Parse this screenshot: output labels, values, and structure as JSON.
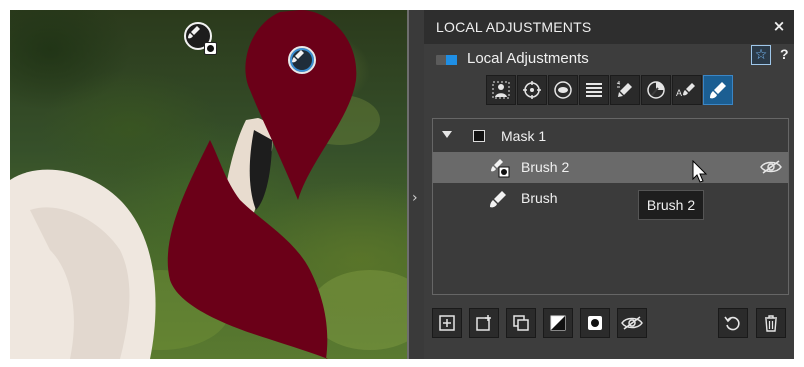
{
  "panel": {
    "title": "LOCAL ADJUSTMENTS",
    "close_label": "×",
    "subtitle": "Local Adjustments",
    "help_label": "?",
    "accent_color": "#1f8fe5"
  },
  "toolbar": {
    "tools": [
      {
        "icon": "automask-icon"
      },
      {
        "icon": "control-point-icon"
      },
      {
        "icon": "radial-mask-icon"
      },
      {
        "icon": "graduated-mask-icon"
      },
      {
        "icon": "color-picker-icon"
      },
      {
        "icon": "auto-mask-brush-icon"
      },
      {
        "icon": "auto-brush-icon"
      },
      {
        "icon": "brush-icon",
        "active": true
      }
    ]
  },
  "layers": {
    "mask": {
      "label": "Mask 1"
    },
    "items": [
      {
        "label": "Brush 2",
        "selected": true,
        "icon": "brush-badge-icon"
      },
      {
        "label": "Brush",
        "selected": false,
        "icon": "brush-icon"
      }
    ]
  },
  "tooltip": {
    "text": "Brush 2"
  },
  "bottom_bar": {
    "buttons": [
      "add-mask-icon",
      "add-layer-icon",
      "duplicate-icon",
      "invert-icon",
      "show-mask-icon",
      "visibility-icon",
      "reset-icon",
      "delete-icon"
    ]
  },
  "canvas": {
    "mask_color": "#6b0018"
  }
}
